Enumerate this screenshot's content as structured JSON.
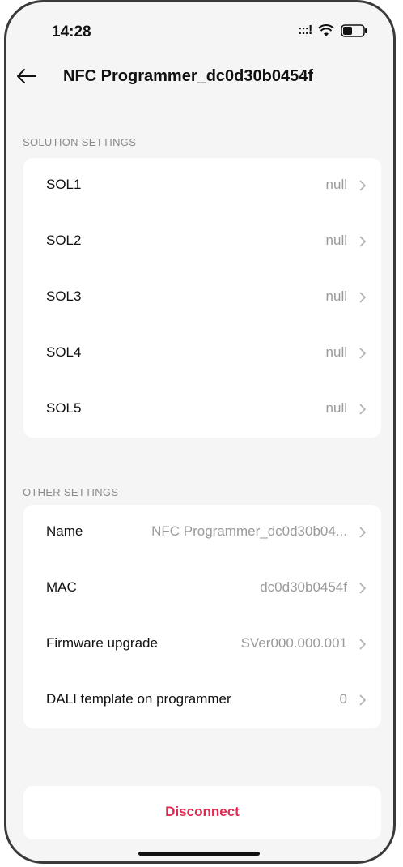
{
  "status_bar": {
    "time": "14:28",
    "signal_glyph": ":::!"
  },
  "header": {
    "title": "NFC Programmer_dc0d30b0454f"
  },
  "solution_settings": {
    "section_label": "SOLUTION SETTINGS",
    "items": [
      {
        "label": "SOL1",
        "value": "null"
      },
      {
        "label": "SOL2",
        "value": "null"
      },
      {
        "label": "SOL3",
        "value": "null"
      },
      {
        "label": "SOL4",
        "value": "null"
      },
      {
        "label": "SOL5",
        "value": "null"
      }
    ]
  },
  "other_settings": {
    "section_label": "OTHER SETTINGS",
    "items": [
      {
        "label": "Name",
        "value": "NFC Programmer_dc0d30b04..."
      },
      {
        "label": "MAC",
        "value": "dc0d30b0454f"
      },
      {
        "label": "Firmware upgrade",
        "value": "SVer000.000.001"
      },
      {
        "label": "DALI template on programmer",
        "value": "0"
      }
    ]
  },
  "disconnect": {
    "label": "Disconnect"
  },
  "colors": {
    "accent": "#e02c52",
    "background": "#f5f5f5",
    "card": "#ffffff"
  }
}
